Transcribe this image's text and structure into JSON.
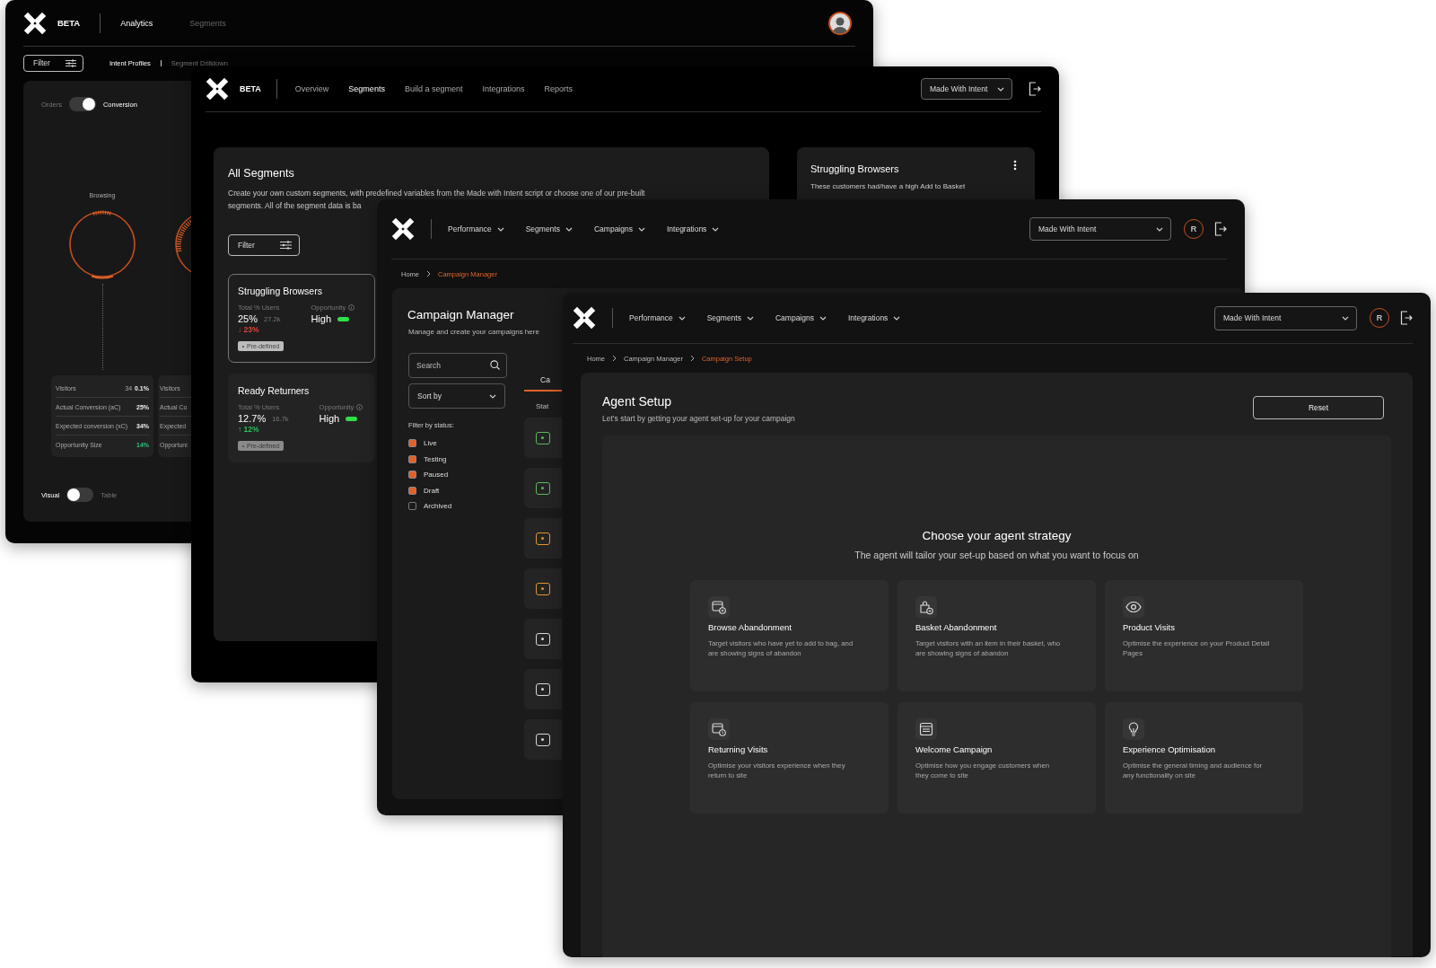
{
  "analytics_window": {
    "brand": "BETA",
    "nav": [
      {
        "label": "Analytics",
        "selected": true
      },
      {
        "label": "Segments",
        "selected": false
      }
    ],
    "filter_button": "Filter",
    "subnav": [
      {
        "label": "Intent Profiles",
        "selected": true
      },
      {
        "label": "Segment Drilldown",
        "selected": false
      }
    ],
    "metric_toggle": {
      "left_label": "Orders",
      "right_label": "Conversion",
      "on": true
    },
    "ring_label": "Browsing",
    "stat_cards": [
      {
        "rows": [
          {
            "label": "Visitors",
            "count": "34",
            "value": "0.1%",
            "highlight": false
          },
          {
            "label": "Actual Conversion (aC)",
            "value": "25%",
            "highlight": false
          },
          {
            "label": "Expected conversion (xC)",
            "value": "34%",
            "highlight": false
          },
          {
            "label": "Opportunity Size",
            "value": "14%",
            "highlight": true
          }
        ]
      },
      {
        "rows": [
          {
            "label": "Visitors"
          },
          {
            "label": "Actual Co"
          },
          {
            "label": "Expected"
          },
          {
            "label": "Opportuni"
          }
        ]
      }
    ],
    "view_toggle": {
      "left_label": "Visual",
      "right_label": "Table",
      "on": false
    }
  },
  "segments_window": {
    "brand": "BETA",
    "nav": [
      {
        "label": "Overview",
        "selected": false
      },
      {
        "label": "Segments",
        "selected": true
      },
      {
        "label": "Build a segment",
        "selected": false
      },
      {
        "label": "Integrations",
        "selected": false
      },
      {
        "label": "Reports",
        "selected": false
      }
    ],
    "account": "Made With Intent",
    "title": "All Segments",
    "description_lines": [
      "Create your own custom segments, with predefined variables from the Made with Intent script or choose one of our pre-built",
      "segments. All of the segment data is ba"
    ],
    "filter_button": "Filter",
    "segments": [
      {
        "title": "Struggling Browsers",
        "users_label": "Total % Users",
        "share": "25%",
        "count": "27.2k",
        "change": "↓ 23%",
        "color": "#d9453a",
        "opportunity_label": "Opportunity",
        "opportunity": "High",
        "tag": "Pre-defined",
        "selected": true
      },
      {
        "title": "Ready Returners",
        "users_label": "Total % Users",
        "share": "12.7%",
        "count": "16.7k",
        "change": "↑ 12%",
        "color": "#2fbf5a",
        "opportunity_label": "Opportunity",
        "opportunity": "High",
        "tag": "Pre-defined",
        "selected": false
      }
    ],
    "detail": {
      "title": "Struggling Browsers",
      "text": "These customers had/have a high Add to Basket"
    }
  },
  "campaigns_window": {
    "nav": [
      {
        "label": "Performance"
      },
      {
        "label": "Segments"
      },
      {
        "label": "Campaigns"
      },
      {
        "label": "Integrations"
      }
    ],
    "account": "Made With Intent",
    "avatar": "R",
    "breadcrumb": [
      {
        "label": "Home",
        "current": false
      },
      {
        "label": "Campaign Manager",
        "current": true
      }
    ],
    "title": "Campaign Manager",
    "subtitle": "Manage and create your campaigns here",
    "search": {
      "placeholder": "Search"
    },
    "sort": "Sort by",
    "filter_label": "Filter by status:",
    "statuses": [
      {
        "label": "Live",
        "checked": true
      },
      {
        "label": "Testing",
        "checked": true
      },
      {
        "label": "Paused",
        "checked": true
      },
      {
        "label": "Draft",
        "checked": true
      },
      {
        "label": "Archived",
        "checked": false
      }
    ],
    "tabs": [
      {
        "label": "Ca",
        "selected": true
      }
    ],
    "column_header": "Stat",
    "campaign_rows": [
      {
        "color": "#5cb85c"
      },
      {
        "color": "#5cb85c"
      },
      {
        "color": "#e0962a"
      },
      {
        "color": "#e0962a"
      },
      {
        "color": "#d8d8d8"
      },
      {
        "color": "#d8d8d8"
      },
      {
        "color": "#d8d8d8"
      }
    ]
  },
  "setup_window": {
    "nav": [
      {
        "label": "Performance"
      },
      {
        "label": "Segments"
      },
      {
        "label": "Campaigns"
      },
      {
        "label": "Integrations"
      }
    ],
    "account": "Made With Intent",
    "avatar": "R",
    "breadcrumb": [
      {
        "label": "Home",
        "current": false
      },
      {
        "label": "Campaign Manager",
        "current": false
      },
      {
        "label": "Campaign Setup",
        "current": true
      }
    ],
    "title": "Agent Setup",
    "subtitle": "Let’s start by getting your agent set-up for your campaign",
    "reset_button": "Reset",
    "strategy_title": "Choose your agent strategy",
    "strategy_subtitle": "The agent will tailor your set-up based on what you want to focus on",
    "strategies": [
      {
        "title": "Browse Abandonment",
        "description": "Target visitors who have yet to add to bag, and are showing signs of abandon"
      },
      {
        "title": "Basket Abandonment",
        "description": "Target visitors with an item in their basket, who are showing signs of abandon"
      },
      {
        "title": "Product Visits",
        "description": "Optimise the experience on your Product Detail Pages"
      },
      {
        "title": "Returning Visits",
        "description": "Optimise your visitors experience when they return to site"
      },
      {
        "title": "Welcome Campaign",
        "description": "Optimise how you engage customers when they come to site"
      },
      {
        "title": "Experience Optimisation",
        "description": "Optimise the general timing and audience for any functionality on site"
      }
    ]
  }
}
